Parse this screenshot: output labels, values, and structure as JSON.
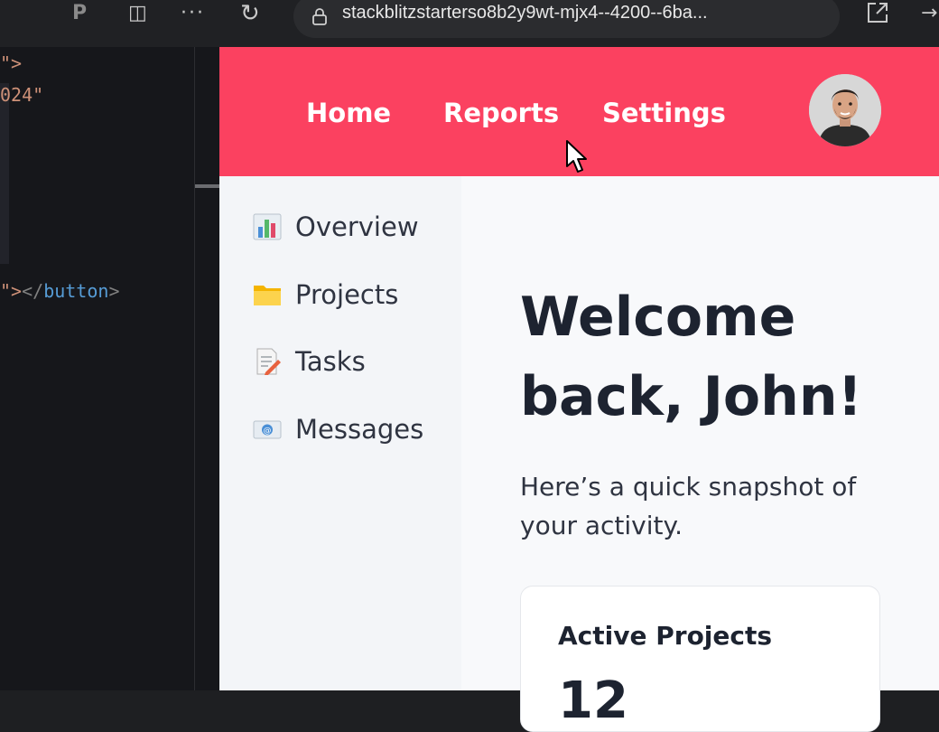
{
  "browser": {
    "url": "stackblitzstarterso8b2y9wt-mjx4--4200--6ba..."
  },
  "editor": {
    "line1": "\">",
    "line2": "024\"",
    "line3_quote": "\">",
    "line3_close_open": "</",
    "line3_tag": "button",
    "line3_close_end": ">"
  },
  "nav": {
    "home": "Home",
    "reports": "Reports",
    "settings": "Settings"
  },
  "sidebar": {
    "items": [
      {
        "label": "Overview",
        "icon": "bar-chart-icon"
      },
      {
        "label": "Projects",
        "icon": "folder-icon"
      },
      {
        "label": "Tasks",
        "icon": "memo-icon"
      },
      {
        "label": "Messages",
        "icon": "envelope-icon"
      }
    ]
  },
  "main": {
    "heading": "Welcome back, John!",
    "subtitle": "Here’s a quick snapshot of your activity.",
    "card": {
      "title": "Active Projects",
      "value": "12"
    }
  },
  "colors": {
    "nav_bg": "#fb4160",
    "sidebar_bg": "#f3f5f8",
    "page_bg": "#f8f9fb",
    "text_dark": "#1d2330"
  }
}
